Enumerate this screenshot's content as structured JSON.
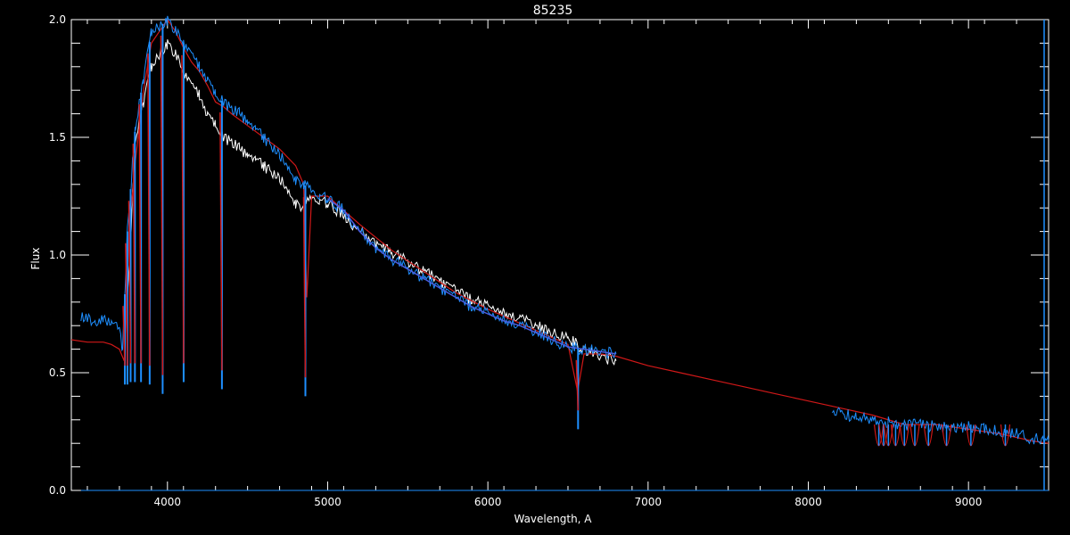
{
  "chart_data": {
    "type": "line",
    "title": "85235",
    "xlabel": "Wavelength, A",
    "ylabel": "Flux",
    "xlim": [
      3400,
      9500
    ],
    "ylim": [
      0.0,
      2.0
    ],
    "x_ticks": [
      4000,
      5000,
      6000,
      7000,
      8000,
      9000
    ],
    "x_tick_labels": [
      "4000",
      "5000",
      "6000",
      "7000",
      "8000",
      "9000"
    ],
    "y_ticks": [
      0.0,
      0.5,
      1.0,
      1.5,
      2.0
    ],
    "y_tick_labels": [
      "0.0",
      "0.5",
      "1.0",
      "1.5",
      "2.0"
    ],
    "grid": false,
    "colors": {
      "background": "#000000",
      "axes": "#ffffff",
      "observed_blue": "#1e8fff",
      "observed_white": "#ffffff",
      "model": "#d01818",
      "model_blue": "#4a5de0"
    },
    "series": [
      {
        "key": "white",
        "x": [
          3750,
          3800,
          3850,
          3900,
          3950,
          4000,
          4050,
          4100,
          4150,
          4200,
          4250,
          4300,
          4350,
          4400,
          4450,
          4500,
          4550,
          4600,
          4650,
          4700,
          4750,
          4800,
          4850,
          4900,
          4950,
          5000,
          5100,
          5200,
          5300,
          5400,
          5500,
          5600,
          5700,
          5800,
          5900,
          6000,
          6100,
          6200,
          6300,
          6400,
          6500,
          6600,
          6700,
          6800
        ],
        "y": [
          0.8,
          1.5,
          1.65,
          1.8,
          1.85,
          1.9,
          1.85,
          1.78,
          1.72,
          1.68,
          1.6,
          1.55,
          1.5,
          1.48,
          1.45,
          1.43,
          1.4,
          1.38,
          1.35,
          1.32,
          1.28,
          1.22,
          1.2,
          1.25,
          1.24,
          1.22,
          1.17,
          1.1,
          1.05,
          1.01,
          0.97,
          0.93,
          0.89,
          0.85,
          0.81,
          0.78,
          0.75,
          0.73,
          0.7,
          0.67,
          0.65,
          0.6,
          0.57,
          0.55
        ]
      },
      {
        "key": "model",
        "x": [
          3400,
          3500,
          3600,
          3650,
          3700,
          3730,
          3760,
          3800,
          3850,
          3900,
          3950,
          4000,
          4050,
          4100,
          4150,
          4200,
          4250,
          4300,
          4350,
          4400,
          4500,
          4600,
          4700,
          4800,
          4850,
          4870,
          4900,
          5000,
          5200,
          5400,
          5600,
          5800,
          6000,
          6200,
          6400,
          6500,
          6560,
          6600,
          6700,
          6800,
          7000,
          7200,
          7400,
          7600,
          7800,
          8000,
          8200,
          8400,
          8600,
          8800,
          9000,
          9200,
          9400,
          9500
        ],
        "y": [
          0.64,
          0.63,
          0.63,
          0.62,
          0.6,
          0.55,
          1.1,
          1.4,
          1.7,
          1.9,
          1.95,
          2.0,
          1.95,
          1.88,
          1.82,
          1.78,
          1.72,
          1.65,
          1.63,
          1.6,
          1.55,
          1.5,
          1.45,
          1.38,
          1.3,
          0.82,
          1.25,
          1.25,
          1.13,
          1.02,
          0.93,
          0.84,
          0.77,
          0.71,
          0.65,
          0.62,
          0.42,
          0.58,
          0.58,
          0.57,
          0.53,
          0.5,
          0.47,
          0.44,
          0.41,
          0.38,
          0.35,
          0.32,
          0.28,
          0.28,
          0.26,
          0.24,
          0.21,
          0.2
        ]
      },
      {
        "key": "blue_main",
        "x": [
          3460,
          3500,
          3550,
          3600,
          3650,
          3700,
          3720,
          3750,
          3800,
          3850,
          3900,
          3950,
          4000,
          4050,
          4100,
          4150,
          4200,
          4250,
          4300,
          4350,
          4400,
          4450,
          4500,
          4550,
          4600,
          4650,
          4700,
          4750,
          4800,
          4850,
          4900,
          4950,
          5000,
          5100,
          5200,
          5300,
          5400,
          5500,
          5600,
          5700,
          5800,
          5900,
          6000,
          6100,
          6200,
          6300,
          6400,
          6500,
          6600,
          6700,
          6800
        ],
        "y": [
          0.74,
          0.73,
          0.72,
          0.72,
          0.71,
          0.68,
          0.6,
          1.1,
          1.55,
          1.75,
          1.95,
          1.97,
          2.0,
          1.95,
          1.9,
          1.85,
          1.8,
          1.75,
          1.68,
          1.65,
          1.62,
          1.6,
          1.57,
          1.53,
          1.5,
          1.46,
          1.42,
          1.38,
          1.32,
          1.3,
          1.28,
          1.26,
          1.24,
          1.19,
          1.1,
          1.03,
          0.98,
          0.94,
          0.9,
          0.86,
          0.82,
          0.78,
          0.75,
          0.72,
          0.7,
          0.67,
          0.64,
          0.61,
          0.6,
          0.59,
          0.58
        ]
      },
      {
        "key": "blue_red",
        "x": [
          8150,
          8200,
          8300,
          8400,
          8500,
          8600,
          8700,
          8800,
          8900,
          9000,
          9100,
          9200,
          9300,
          9400,
          9500
        ],
        "y": [
          0.34,
          0.33,
          0.31,
          0.3,
          0.29,
          0.28,
          0.28,
          0.27,
          0.27,
          0.27,
          0.26,
          0.25,
          0.24,
          0.22,
          0.21
        ]
      },
      {
        "key": "baseline",
        "x": [
          3460,
          9500
        ],
        "y": [
          0.0,
          0.0
        ]
      }
    ],
    "absorption_lines": [
      {
        "x": 3734,
        "depth": 0.45
      },
      {
        "x": 3750,
        "depth": 0.45
      },
      {
        "x": 3770,
        "depth": 0.46
      },
      {
        "x": 3797,
        "depth": 0.46
      },
      {
        "x": 3835,
        "depth": 0.46
      },
      {
        "x": 3889,
        "depth": 0.45
      },
      {
        "x": 3970,
        "depth": 0.41
      },
      {
        "x": 4101,
        "depth": 0.46
      },
      {
        "x": 4340,
        "depth": 0.43
      },
      {
        "x": 4861,
        "depth": 0.4
      },
      {
        "x": 6563,
        "depth": 0.26
      }
    ],
    "paschen_lines": [
      8440,
      8470,
      8500,
      8545,
      8600,
      8665,
      8750,
      8863,
      9015,
      9230
    ]
  }
}
